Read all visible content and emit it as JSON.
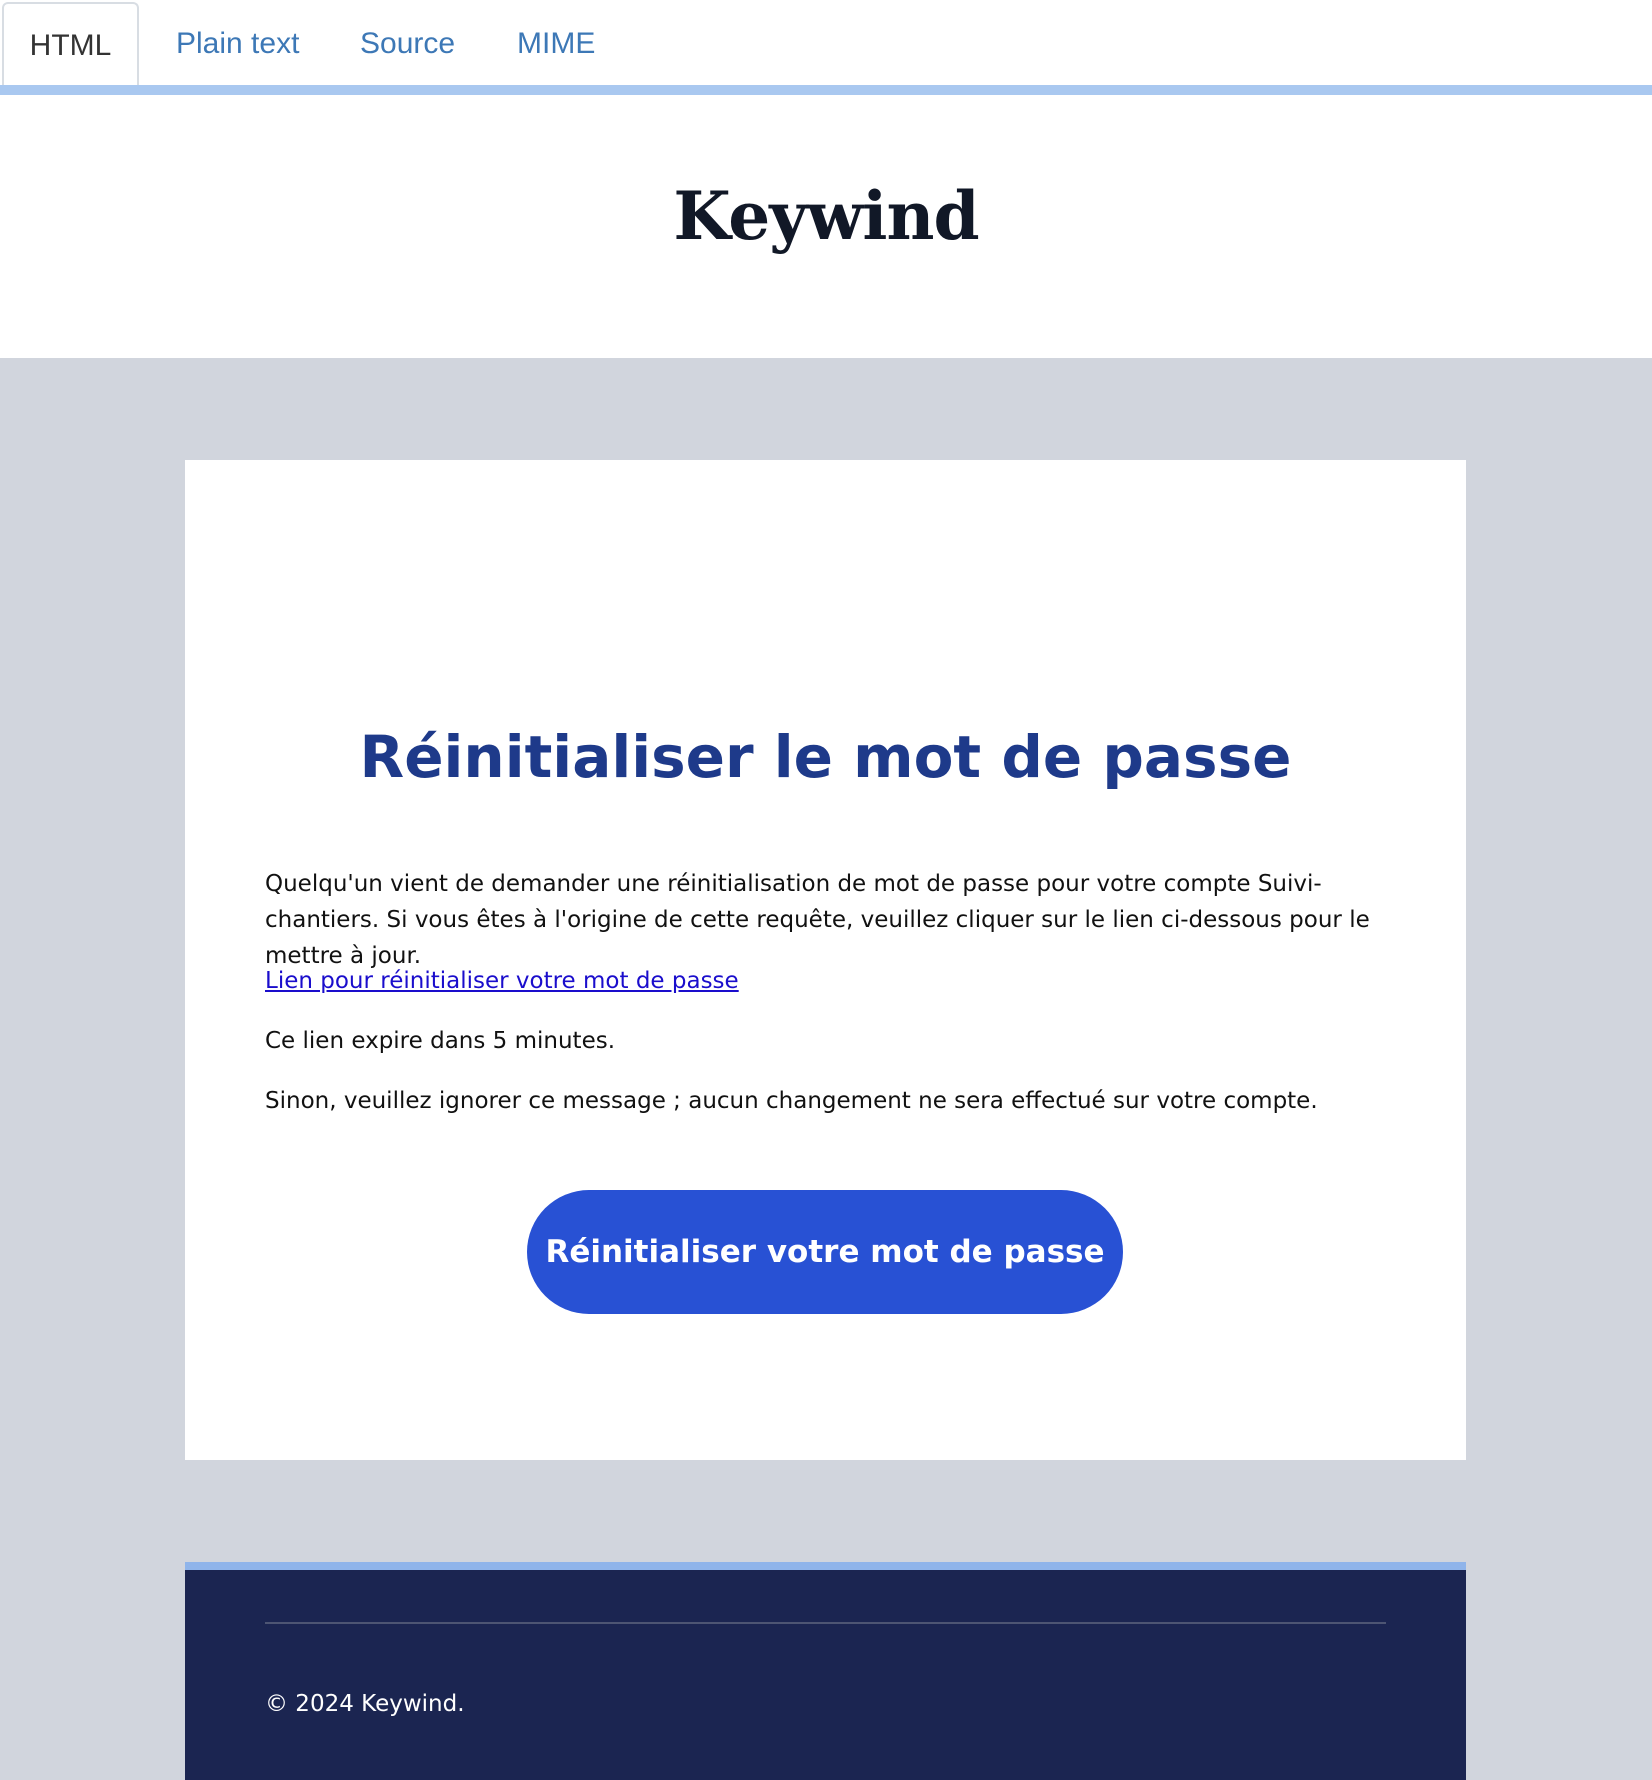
{
  "tabs": [
    {
      "label": "HTML",
      "active": true
    },
    {
      "label": "Plain text",
      "active": false
    },
    {
      "label": "Source",
      "active": false
    },
    {
      "label": "MIME",
      "active": false
    }
  ],
  "header": {
    "logo": "Keywind"
  },
  "email": {
    "title": "Réinitialiser le mot de passe",
    "intro": "Quelqu'un vient de demander une réinitialisation de mot de passe pour votre compte Suivi-chantiers. Si vous êtes à l'origine de cette requête, veuillez cliquer sur le lien ci-dessous pour le mettre à jour.",
    "link_label": "Lien pour réinitialiser votre mot de passe",
    "expiry": "Ce lien expire dans 5 minutes.",
    "ignore_notice": "Sinon, veuillez ignorer ce message ; aucun changement ne sera effectué sur votre compte.",
    "button_label": "Réinitialiser votre mot de passe"
  },
  "footer": {
    "copyright": "© 2024 Keywind."
  },
  "colors": {
    "tab_link": "#3d78b6",
    "tab_underline": "#a9c8f0",
    "logo": "#111827",
    "background_grey": "#d1d5dd",
    "title": "#1e3a8a",
    "link": "#1a0dcc",
    "button": "#2851d4",
    "footer": "#1b2551",
    "footer_accent": "#8fb4ea"
  }
}
